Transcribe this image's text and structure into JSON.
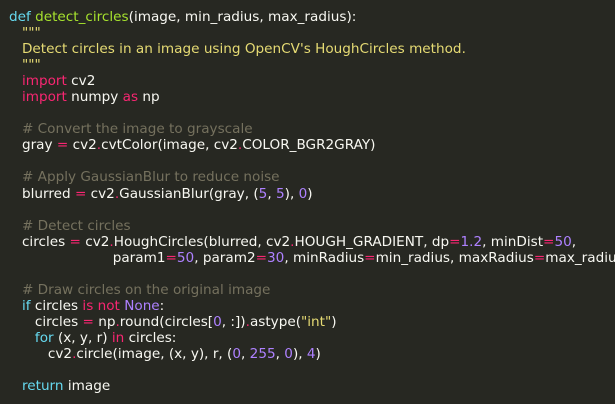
{
  "code": {
    "lines": [
      [
        {
          "t": "kw",
          "v": "def "
        },
        {
          "t": "fn",
          "v": "detect_circles"
        },
        {
          "t": "plain",
          "v": "(image, min_radius, max_radius):"
        }
      ],
      [
        {
          "t": "str",
          "v": "   \"\"\""
        }
      ],
      [
        {
          "t": "str",
          "v": "   Detect circles in an image using OpenCV's HoughCircles method."
        }
      ],
      [
        {
          "t": "str",
          "v": "   \"\"\""
        }
      ],
      [
        {
          "t": "op",
          "v": "   import"
        },
        {
          "t": "plain",
          "v": " cv2"
        }
      ],
      [
        {
          "t": "op",
          "v": "   import"
        },
        {
          "t": "plain",
          "v": " numpy "
        },
        {
          "t": "op",
          "v": "as"
        },
        {
          "t": "plain",
          "v": " np"
        }
      ],
      [],
      [
        {
          "t": "cmt",
          "v": "   # Convert the image to grayscale"
        }
      ],
      [
        {
          "t": "plain",
          "v": "   gray "
        },
        {
          "t": "op",
          "v": "="
        },
        {
          "t": "plain",
          "v": " cv2"
        },
        {
          "t": "op",
          "v": "."
        },
        {
          "t": "plain",
          "v": "cvtColor(image, cv2"
        },
        {
          "t": "op",
          "v": "."
        },
        {
          "t": "plain",
          "v": "COLOR_BGR2GRAY)"
        }
      ],
      [],
      [
        {
          "t": "cmt",
          "v": "   # Apply GaussianBlur to reduce noise"
        }
      ],
      [
        {
          "t": "plain",
          "v": "   blurred "
        },
        {
          "t": "op",
          "v": "="
        },
        {
          "t": "plain",
          "v": " cv2"
        },
        {
          "t": "op",
          "v": "."
        },
        {
          "t": "plain",
          "v": "GaussianBlur(gray, ("
        },
        {
          "t": "num",
          "v": "5"
        },
        {
          "t": "plain",
          "v": ", "
        },
        {
          "t": "num",
          "v": "5"
        },
        {
          "t": "plain",
          "v": "), "
        },
        {
          "t": "num",
          "v": "0"
        },
        {
          "t": "plain",
          "v": ")"
        }
      ],
      [],
      [
        {
          "t": "cmt",
          "v": "   # Detect circles"
        }
      ],
      [
        {
          "t": "plain",
          "v": "   circles "
        },
        {
          "t": "op",
          "v": "="
        },
        {
          "t": "plain",
          "v": " cv2"
        },
        {
          "t": "op",
          "v": "."
        },
        {
          "t": "plain",
          "v": "HoughCircles(blurred, cv2"
        },
        {
          "t": "op",
          "v": "."
        },
        {
          "t": "plain",
          "v": "HOUGH_GRADIENT, dp"
        },
        {
          "t": "op",
          "v": "="
        },
        {
          "t": "num",
          "v": "1.2"
        },
        {
          "t": "plain",
          "v": ", minDist"
        },
        {
          "t": "op",
          "v": "="
        },
        {
          "t": "num",
          "v": "50"
        },
        {
          "t": "plain",
          "v": ","
        }
      ],
      [
        {
          "t": "plain",
          "v": "                        param1"
        },
        {
          "t": "op",
          "v": "="
        },
        {
          "t": "num",
          "v": "50"
        },
        {
          "t": "plain",
          "v": ", param2"
        },
        {
          "t": "op",
          "v": "="
        },
        {
          "t": "num",
          "v": "30"
        },
        {
          "t": "plain",
          "v": ", minRadius"
        },
        {
          "t": "op",
          "v": "="
        },
        {
          "t": "plain",
          "v": "min_radius, maxRadius"
        },
        {
          "t": "op",
          "v": "="
        },
        {
          "t": "plain",
          "v": "max_radius)"
        }
      ],
      [],
      [
        {
          "t": "cmt",
          "v": "   # Draw circles on the original image"
        }
      ],
      [
        {
          "t": "kw",
          "v": "   if"
        },
        {
          "t": "plain",
          "v": " circles "
        },
        {
          "t": "op",
          "v": "is not"
        },
        {
          "t": "plain",
          "v": " "
        },
        {
          "t": "num",
          "v": "None"
        },
        {
          "t": "plain",
          "v": ":"
        }
      ],
      [
        {
          "t": "plain",
          "v": "      circles "
        },
        {
          "t": "op",
          "v": "="
        },
        {
          "t": "plain",
          "v": " np"
        },
        {
          "t": "op",
          "v": "."
        },
        {
          "t": "plain",
          "v": "round(circles["
        },
        {
          "t": "num",
          "v": "0"
        },
        {
          "t": "plain",
          "v": ", :])"
        },
        {
          "t": "op",
          "v": "."
        },
        {
          "t": "plain",
          "v": "astype("
        },
        {
          "t": "str",
          "v": "\"int\""
        },
        {
          "t": "plain",
          "v": ")"
        }
      ],
      [
        {
          "t": "kw",
          "v": "      for"
        },
        {
          "t": "plain",
          "v": " (x, y, r) "
        },
        {
          "t": "op",
          "v": "in"
        },
        {
          "t": "plain",
          "v": " circles:"
        }
      ],
      [
        {
          "t": "plain",
          "v": "         cv2"
        },
        {
          "t": "op",
          "v": "."
        },
        {
          "t": "plain",
          "v": "circle(image, (x, y), r, ("
        },
        {
          "t": "num",
          "v": "0"
        },
        {
          "t": "plain",
          "v": ", "
        },
        {
          "t": "num",
          "v": "255"
        },
        {
          "t": "plain",
          "v": ", "
        },
        {
          "t": "num",
          "v": "0"
        },
        {
          "t": "plain",
          "v": "), "
        },
        {
          "t": "num",
          "v": "4"
        },
        {
          "t": "plain",
          "v": ")"
        }
      ],
      [],
      [
        {
          "t": "kw",
          "v": "   return"
        },
        {
          "t": "plain",
          "v": " image"
        }
      ]
    ]
  },
  "colors": {
    "background": "#272822",
    "keyword": "#66d9ef",
    "function": "#a6e22e",
    "string": "#e6db74",
    "number": "#ae81ff",
    "comment": "#75715e",
    "operator": "#f92672",
    "text": "#f8f8f2"
  }
}
